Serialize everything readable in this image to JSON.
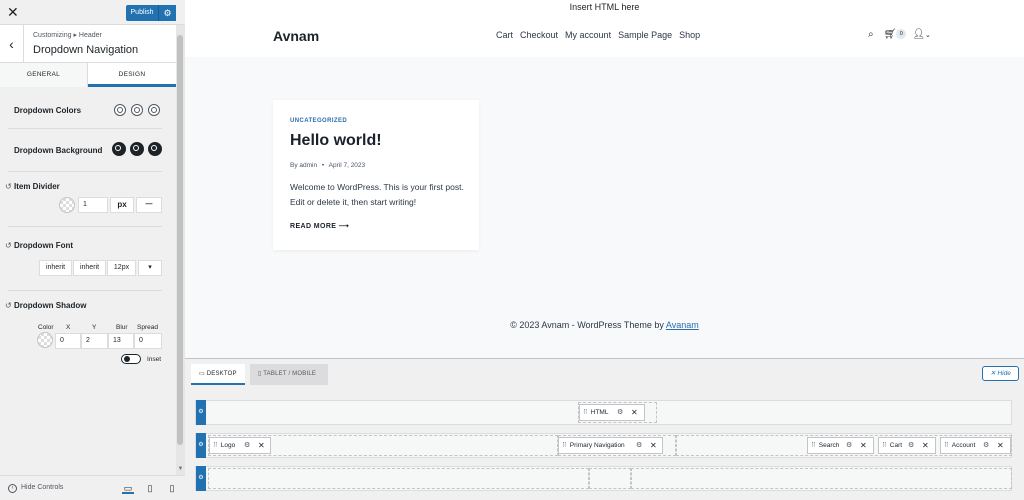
{
  "customizer": {
    "close_icon": "close-icon",
    "publish_label": "Publish",
    "breadcrumb": "Customizing ▸ Header",
    "title": "Dropdown Navigation",
    "tabs": [
      "GENERAL",
      "DESIGN"
    ],
    "active_tab": "DESIGN",
    "dropdown_colors_label": "Dropdown Colors",
    "dropdown_background_label": "Dropdown Background",
    "item_divider_label": "Item Divider",
    "item_divider": {
      "width": "1",
      "unit": "px",
      "style": "—"
    },
    "dropdown_font_label": "Dropdown Font",
    "dropdown_font": {
      "family": "inherit",
      "weight": "inherit",
      "size": "12px",
      "caret": "▾"
    },
    "dropdown_shadow_label": "Dropdown Shadow",
    "shadow_headers": [
      "Color",
      "X",
      "Y",
      "Blur",
      "Spread"
    ],
    "shadow_values": {
      "x": "0",
      "y": "2",
      "blur": "13",
      "spread": "0"
    },
    "inset_label": "Inset",
    "hide_controls_label": "Hide Controls",
    "accent_color": "#2271b1"
  },
  "site": {
    "top_bar": "Insert HTML here",
    "logo": "Avnam",
    "nav": [
      "Cart",
      "Checkout",
      "My account",
      "Sample Page",
      "Shop"
    ],
    "cart_count": "0",
    "post": {
      "category": "UNCATEGORIZED",
      "title": "Hello world!",
      "author": "By admin",
      "bullet": "•",
      "date": "April 7, 2023",
      "excerpt": "Welcome to WordPress. This is your first post. Edit or delete it, then start writing!",
      "read_more": "READ MORE ⟶"
    },
    "footer_text": "© 2023 Avnam - WordPress Theme by ",
    "footer_link": "Avanam"
  },
  "builder": {
    "tabs": [
      "DESKTOP",
      "TABLET / MOBILE"
    ],
    "hide_label": "✕ Hide",
    "top_row": [
      {
        "label": "HTML"
      }
    ],
    "main_row": [
      {
        "label": "Logo"
      },
      {
        "label": "Primary Navigation"
      },
      {
        "label": "Search"
      },
      {
        "label": "Cart"
      },
      {
        "label": "Account"
      }
    ]
  }
}
